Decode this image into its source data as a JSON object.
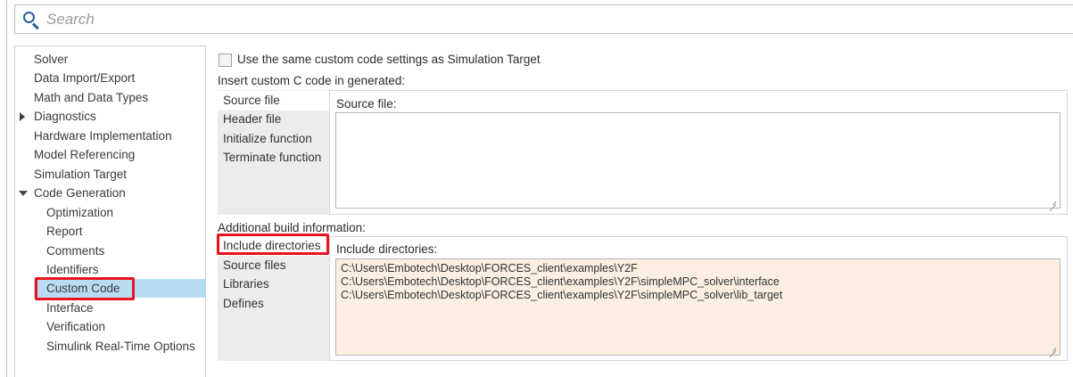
{
  "search": {
    "placeholder": "Search"
  },
  "nav": {
    "items": [
      {
        "label": "Solver"
      },
      {
        "label": "Data Import/Export"
      },
      {
        "label": "Math and Data Types"
      },
      {
        "label": "Diagnostics",
        "expandable": true
      },
      {
        "label": "Hardware Implementation"
      },
      {
        "label": "Model Referencing"
      },
      {
        "label": "Simulation Target"
      },
      {
        "label": "Code Generation",
        "expanded": true
      },
      {
        "label": "Optimization"
      },
      {
        "label": "Report"
      },
      {
        "label": "Comments"
      },
      {
        "label": "Identifiers"
      },
      {
        "label": "Custom Code",
        "selected": true
      },
      {
        "label": "Interface"
      },
      {
        "label": "Verification"
      },
      {
        "label": "Simulink Real-Time Options"
      }
    ]
  },
  "content": {
    "checkbox_label": "Use the same custom code settings as Simulation Target",
    "checkbox_checked": false,
    "insert_heading": "Insert custom C code in generated:",
    "insert_tabs": [
      "Source file",
      "Header file",
      "Initialize function",
      "Terminate function"
    ],
    "insert_panel_label": "Source file:",
    "insert_panel_value": "",
    "build_heading": "Additional build information:",
    "build_tabs": [
      "Include directories",
      "Source files",
      "Libraries",
      "Defines"
    ],
    "build_panel_label": "Include directories:",
    "build_panel_lines": [
      "C:\\Users\\Embotech\\Desktop\\FORCES_client\\examples\\Y2F",
      "C:\\Users\\Embotech\\Desktop\\FORCES_client\\examples\\Y2F\\simpleMPC_solver\\interface",
      "C:\\Users\\Embotech\\Desktop\\FORCES_client\\examples\\Y2F\\simpleMPC_solver\\lib_target"
    ]
  },
  "colors": {
    "highlight_box": "#e8141c",
    "nav_selected_bg": "#b8dcf4",
    "include_dirs_bg": "#fcefe1",
    "search_icon": "#2a5e9a"
  },
  "icons": {
    "search": "magnifier-icon",
    "expand": "triangle-right-icon",
    "collapse": "triangle-down-icon"
  }
}
